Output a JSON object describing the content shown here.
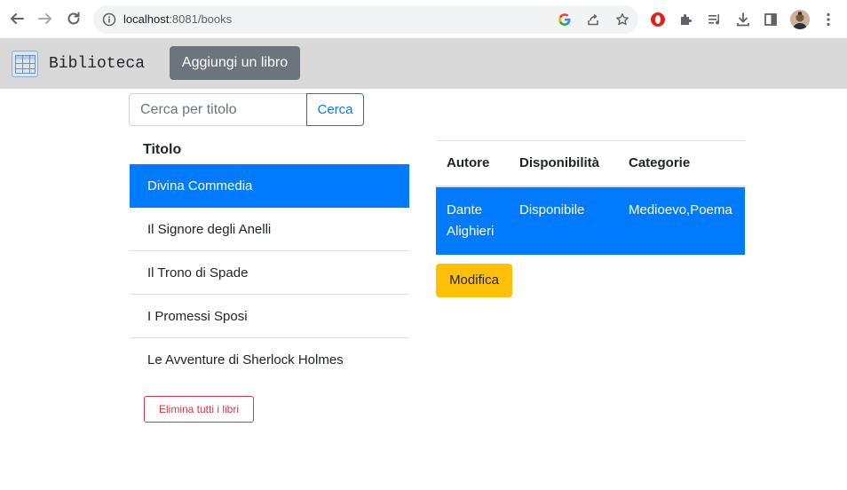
{
  "browser": {
    "url_host": "localhost",
    "url_rest": ":8081/books"
  },
  "navbar": {
    "brand": "Biblioteca",
    "add_button": "Aggiungi un libro"
  },
  "search": {
    "placeholder": "Cerca per titolo",
    "button": "Cerca"
  },
  "list": {
    "heading": "Titolo",
    "items": [
      {
        "label": "Divina Commedia",
        "active": true
      },
      {
        "label": "Il Signore degli Anelli",
        "active": false
      },
      {
        "label": "Il Trono di Spade",
        "active": false
      },
      {
        "label": "I Promessi Sposi",
        "active": false
      },
      {
        "label": "Le Avventure di Sherlock Holmes",
        "active": false
      }
    ],
    "delete_all": "Elimina tutti i libri"
  },
  "detail": {
    "headers": [
      "Autore",
      "Disponibilità",
      "Categorie"
    ],
    "row": [
      "Dante Alighieri",
      "Disponibile",
      "Medioevo,Poema"
    ],
    "edit_button": "Modifica"
  },
  "colors": {
    "primary": "#007bff",
    "secondary": "#6c757d",
    "danger": "#dc3545",
    "warning": "#ffc107",
    "navbar": "#d9d9d9"
  },
  "icons": {
    "back": "arrow-left-icon",
    "forward": "arrow-right-icon",
    "reload": "reload-icon",
    "info": "info-icon",
    "google": "google-icon",
    "share": "share-icon",
    "bookmark": "star-icon",
    "opera": "opera-icon",
    "extensions": "puzzle-icon",
    "media": "playlist-icon",
    "download": "download-icon",
    "sidepanel": "side-panel-icon",
    "profile": "avatar",
    "menu": "kebab-menu-icon"
  }
}
